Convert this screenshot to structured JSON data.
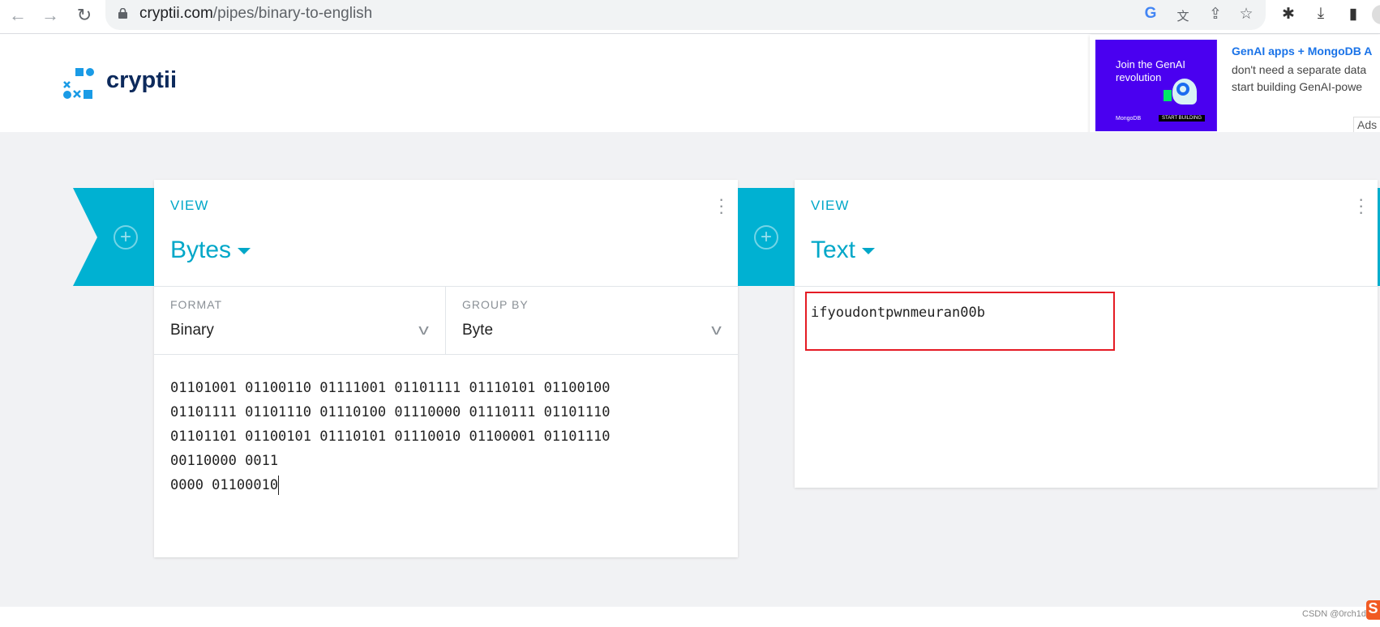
{
  "browser": {
    "url_domain": "cryptii.com",
    "url_path": "/pipes/binary-to-english",
    "icons": [
      "back-icon",
      "forward-icon",
      "reload-icon",
      "lock-icon",
      "google-icon",
      "translate-icon",
      "share-icon",
      "star-icon",
      "extensions-icon",
      "download-icon",
      "sidepanel-icon",
      "profile-icon"
    ]
  },
  "site": {
    "logo_text": "cryptii",
    "brand_color": "#00b1d2"
  },
  "ad": {
    "image_text": "Join the GenAI revolution",
    "image_brand": "MongoDB",
    "image_cta": "START BUILDING",
    "title": "GenAI apps + MongoDB A",
    "body_line1": "don't need a separate data",
    "body_line2": "start building GenAI-powe",
    "label": "Ads"
  },
  "left_card": {
    "kind_label": "VIEW",
    "title": "Bytes",
    "format": {
      "label": "FORMAT",
      "value": "Binary"
    },
    "group_by": {
      "label": "GROUP BY",
      "value": "Byte"
    },
    "content": "01101001 01100110 01111001 01101111 01110101 01100100\n01101111 01101110 01110100 01110000 01110111 01101110\n01101101 01100101 01110101 01110010 01100001 01101110\n00110000 0011\n0000 01100010"
  },
  "right_card": {
    "kind_label": "VIEW",
    "title": "Text",
    "content": "ifyoudontpwnmeuran00b",
    "highlight_color": "#e51b24"
  },
  "watermark": "CSDN @0rch1d"
}
